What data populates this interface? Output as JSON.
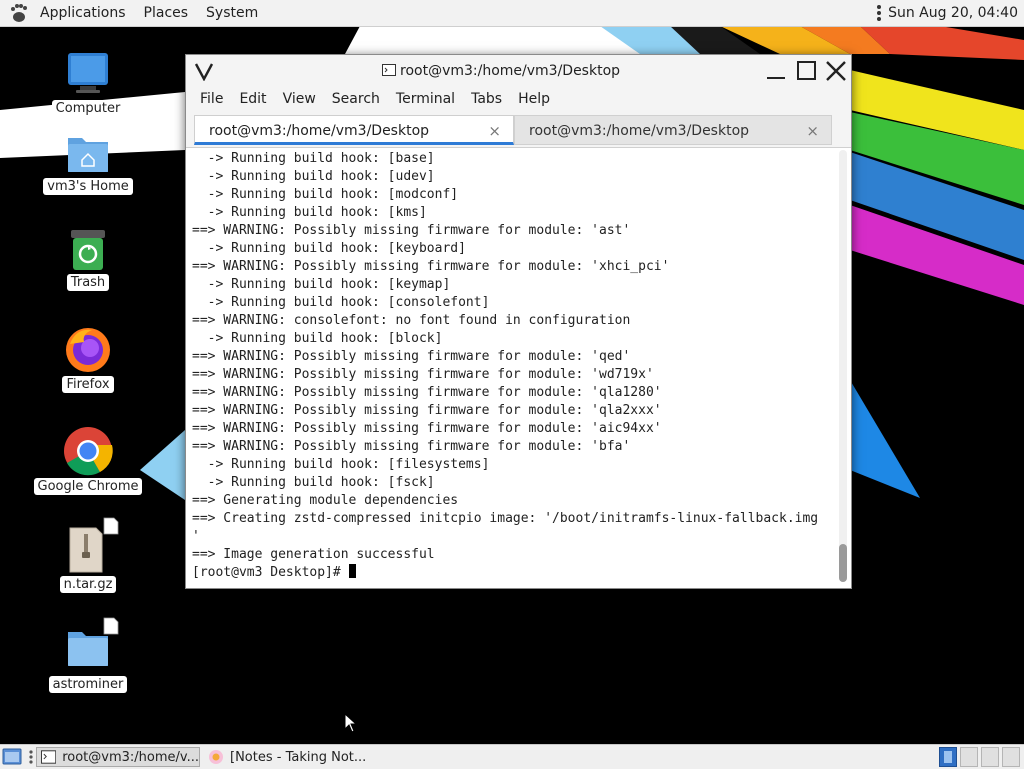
{
  "top_panel": {
    "menus": [
      "Applications",
      "Places",
      "System"
    ],
    "clock": "Sun Aug 20, 04:40"
  },
  "desktop": {
    "icons": [
      {
        "label": "Computer",
        "icon": "computer-icon"
      },
      {
        "label": "vm3's Home",
        "icon": "home-folder-icon"
      },
      {
        "label": "Trash",
        "icon": "trash-icon"
      },
      {
        "label": "Firefox",
        "icon": "firefox-icon"
      },
      {
        "label": "Google Chrome",
        "icon": "chrome-icon"
      },
      {
        "label": "n.tar.gz",
        "icon": "archive-icon"
      },
      {
        "label": "astrominer",
        "icon": "folder-icon"
      }
    ]
  },
  "terminal": {
    "title": "root@vm3:/home/vm3/Desktop",
    "menu": [
      "File",
      "Edit",
      "View",
      "Search",
      "Terminal",
      "Tabs",
      "Help"
    ],
    "tabs": [
      {
        "label": "root@vm3:/home/vm3/Desktop",
        "close": "×"
      },
      {
        "label": "root@vm3:/home/vm3/Desktop",
        "close": "×"
      }
    ],
    "lines": [
      "  -> Running build hook: [base]",
      "  -> Running build hook: [udev]",
      "  -> Running build hook: [modconf]",
      "  -> Running build hook: [kms]",
      "==> WARNING: Possibly missing firmware for module: 'ast'",
      "  -> Running build hook: [keyboard]",
      "==> WARNING: Possibly missing firmware for module: 'xhci_pci'",
      "  -> Running build hook: [keymap]",
      "  -> Running build hook: [consolefont]",
      "==> WARNING: consolefont: no font found in configuration",
      "  -> Running build hook: [block]",
      "==> WARNING: Possibly missing firmware for module: 'qed'",
      "==> WARNING: Possibly missing firmware for module: 'wd719x'",
      "==> WARNING: Possibly missing firmware for module: 'qla1280'",
      "==> WARNING: Possibly missing firmware for module: 'qla2xxx'",
      "==> WARNING: Possibly missing firmware for module: 'aic94xx'",
      "==> WARNING: Possibly missing firmware for module: 'bfa'",
      "  -> Running build hook: [filesystems]",
      "  -> Running build hook: [fsck]",
      "==> Generating module dependencies",
      "==> Creating zstd-compressed initcpio image: '/boot/initramfs-linux-fallback.img",
      "'",
      "==> Image generation successful"
    ],
    "prompt": "[root@vm3 Desktop]# "
  },
  "taskbar": {
    "tasks": [
      {
        "label": "root@vm3:/home/v..."
      },
      {
        "label": "[Notes - Taking Not..."
      }
    ],
    "workspaces": 4,
    "active_workspace": 1
  },
  "colors": {
    "tab_accent": "#2e7bd6",
    "panel_bg": "#f2f2f2"
  }
}
